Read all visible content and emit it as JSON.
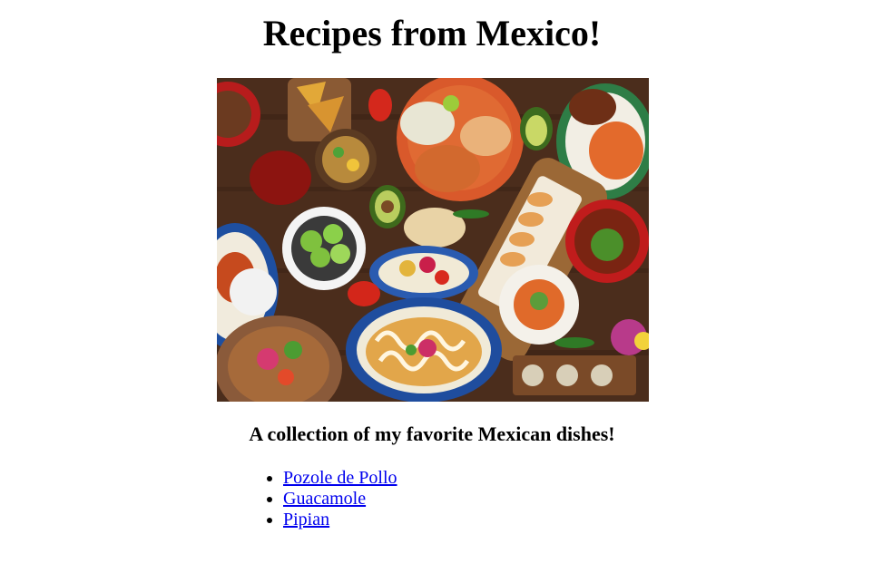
{
  "page": {
    "title": "Recipes from Mexico!",
    "subtitle": "A collection of my favorite Mexican dishes!"
  },
  "hero_image": {
    "icon": "mexican-food-spread-photo"
  },
  "recipes": [
    {
      "label": "Pozole de Pollo"
    },
    {
      "label": "Guacamole"
    },
    {
      "label": "Pipian"
    }
  ],
  "colors": {
    "link": "#0000ee",
    "text": "#000000",
    "background": "#ffffff"
  }
}
